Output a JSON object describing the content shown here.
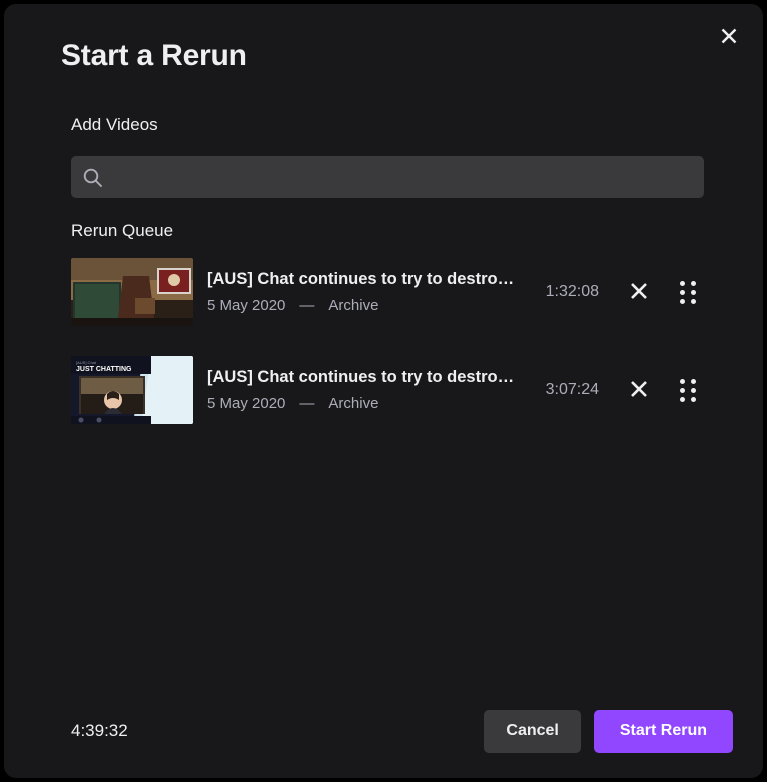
{
  "dialog": {
    "title": "Start a Rerun",
    "close_icon": "close-icon"
  },
  "add_videos": {
    "label": "Add Videos",
    "search": {
      "icon": "search-icon",
      "value": "",
      "placeholder": ""
    }
  },
  "rerun_queue": {
    "label": "Rerun Queue",
    "items": [
      {
        "title": "[AUS] Chat continues to try to destroy…",
        "date": "5 May 2020",
        "separator": "—",
        "type": "Archive",
        "duration": "1:32:08",
        "remove_icon": "close-icon",
        "drag_icon": "drag-handle-icon",
        "thumbnail_alt": "gameplay-thumbnail"
      },
      {
        "title": "[AUS] Chat continues to try to destroy…",
        "date": "5 May 2020",
        "separator": "—",
        "type": "Archive",
        "duration": "3:07:24",
        "remove_icon": "close-icon",
        "drag_icon": "drag-handle-icon",
        "thumbnail_alt": "just-chatting-thumbnail"
      }
    ]
  },
  "footer": {
    "total_duration": "4:39:32",
    "cancel_label": "Cancel",
    "start_label": "Start Rerun"
  },
  "colors": {
    "accent": "#9147ff",
    "modal_bg": "#18181b",
    "field_bg": "#3a3a3d",
    "text_primary": "#efeff1",
    "text_secondary": "#adadb8"
  }
}
